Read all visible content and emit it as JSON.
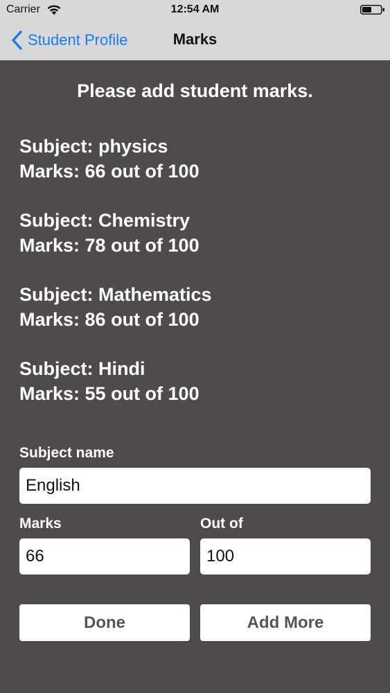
{
  "status_bar": {
    "carrier": "Carrier",
    "time": "12:54 AM",
    "icons": [
      "wifi-icon",
      "battery-icon"
    ]
  },
  "nav": {
    "back_label": "Student Profile",
    "back_icon": "chevron-left-icon",
    "title": "Marks"
  },
  "heading": "Please add student marks.",
  "entries": [
    {
      "subject": "Subject: physics",
      "marks": "Marks: 66 out of 100"
    },
    {
      "subject": "Subject: Chemistry",
      "marks": "Marks: 78 out of 100"
    },
    {
      "subject": "Subject: Mathematics",
      "marks": "Marks: 86 out of 100"
    },
    {
      "subject": "Subject: Hindi",
      "marks": "Marks: 55 out of 100"
    }
  ],
  "form": {
    "subject_label": "Subject name",
    "subject_value": "English",
    "marks_label": "Marks",
    "marks_value": "66",
    "out_of_label": "Out of",
    "out_of_value": "100"
  },
  "buttons": {
    "done": "Done",
    "add_more": "Add More"
  },
  "colors": {
    "background": "#4f4a4e",
    "nav_background": "#d8d8d8",
    "accent": "#1a7bf2",
    "button_text": "#555555"
  }
}
